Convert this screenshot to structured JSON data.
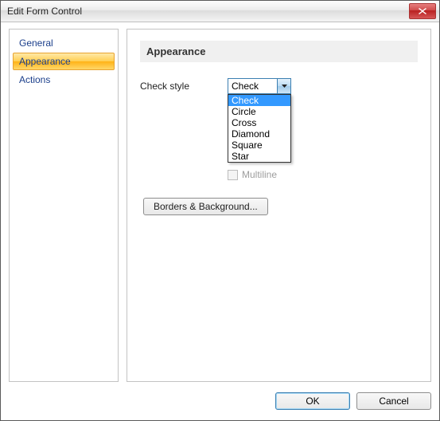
{
  "window": {
    "title": "Edit Form Control"
  },
  "nav": {
    "items": [
      {
        "label": "General"
      },
      {
        "label": "Appearance"
      },
      {
        "label": "Actions"
      }
    ],
    "selected_index": 1
  },
  "section": {
    "heading": "Appearance"
  },
  "check_style": {
    "label": "Check style",
    "selected": "Check",
    "options": [
      "Check",
      "Circle",
      "Cross",
      "Diamond",
      "Square",
      "Star"
    ]
  },
  "multiline": {
    "label": "Multiline",
    "enabled": false,
    "checked": false
  },
  "buttons": {
    "borders_background": "Borders & Background...",
    "ok": "OK",
    "cancel": "Cancel"
  }
}
